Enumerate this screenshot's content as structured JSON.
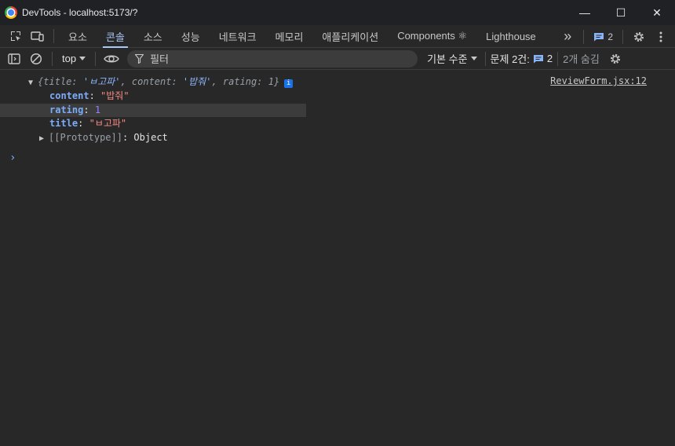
{
  "window": {
    "title": "DevTools - localhost:5173/?",
    "minimize_glyph": "—",
    "maximize_glyph": "☐",
    "close_glyph": "✕"
  },
  "tabs": [
    {
      "label": "요소",
      "active": false
    },
    {
      "label": "콘솔",
      "active": true
    },
    {
      "label": "소스",
      "active": false
    },
    {
      "label": "성능",
      "active": false
    },
    {
      "label": "네트워크",
      "active": false
    },
    {
      "label": "메모리",
      "active": false
    },
    {
      "label": "애플리케이션",
      "active": false
    },
    {
      "label": "Components ⚛",
      "active": false
    },
    {
      "label": "Lighthouse",
      "active": false
    }
  ],
  "tabbar": {
    "more_glyph": "»",
    "issues_count": "2"
  },
  "toolbar": {
    "context": "top",
    "filter_placeholder": "필터",
    "levels_label": "기본 수준",
    "issues_label": "문제 2건:",
    "issues_count": "2",
    "hidden_label": "2개 숨김"
  },
  "console": {
    "summary_open": "{",
    "summary_k1": "title",
    "summary_v1": "'ㅂ고파'",
    "summary_k2": "content",
    "summary_v2": "'밥줘'",
    "summary_k3": "rating",
    "summary_v3": "1",
    "summary_close": "}",
    "info_badge": "i",
    "source_link": "ReviewForm.jsx:12",
    "props": [
      {
        "key": "content",
        "value": "\"밥줘\"",
        "kind": "string"
      },
      {
        "key": "rating",
        "value": "1",
        "kind": "number"
      },
      {
        "key": "title",
        "value": "\"ㅂ고파\"",
        "kind": "string"
      }
    ],
    "prototype_key": "[[Prototype]]",
    "prototype_value": "Object",
    "prompt_glyph": "›"
  },
  "colors": {
    "accent": "#a8c7fa",
    "property_key": "#7cacf8",
    "string_value": "#f28b82",
    "number_value": "#9980ff",
    "background": "#282828"
  }
}
